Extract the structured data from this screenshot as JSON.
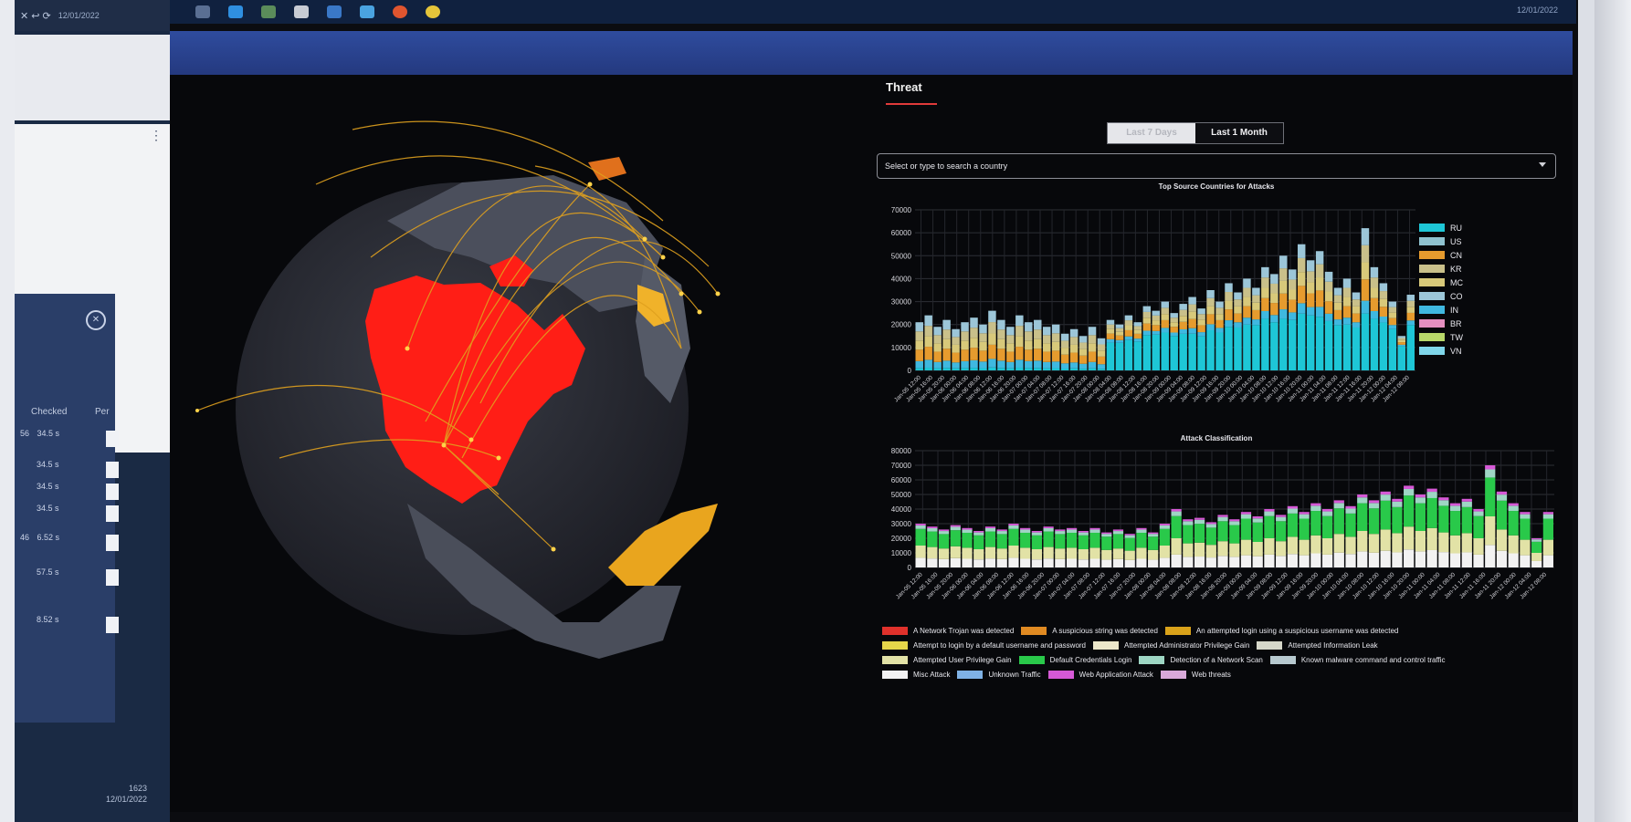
{
  "left_app": {
    "date": "12/01/2022",
    "menu_icon": "kebab-menu-icon",
    "columns": [
      "Checked",
      "Per"
    ],
    "rows": [
      "34.5 s",
      "34.5 s",
      "34.5 s",
      "34.5 s",
      "6.52 s",
      "57.5 s",
      "8.52 s"
    ],
    "row_prefix_first": "56",
    "row_prefix_fifth": "46",
    "clock_time": "1623",
    "clock_date": "12/01/2022"
  },
  "taskbar": {
    "date": "12/01/2022",
    "icons": [
      {
        "name": "file-explorer-icon",
        "color": "#5a6f93"
      },
      {
        "name": "browser-icon",
        "color": "#2f8fe0"
      },
      {
        "name": "folder-icon",
        "color": "#5b8c5a"
      },
      {
        "name": "app-icon",
        "color": "#c8ccd4"
      },
      {
        "name": "store-icon",
        "color": "#3a78c7"
      },
      {
        "name": "mail-icon",
        "color": "#4aa3e0"
      },
      {
        "name": "firefox-icon",
        "color": "#e0552f"
      },
      {
        "name": "chrome-icon",
        "color": "#e5c53a"
      }
    ]
  },
  "dashboard": {
    "tab": "Threat",
    "range_options": [
      "Last 7 Days",
      "Last 1 Month"
    ],
    "search_placeholder": "Select or type to search a country"
  },
  "chart_data": [
    {
      "type": "bar",
      "stacked": true,
      "title": "Top Source Countries for Attacks",
      "ylim": [
        0,
        70000
      ],
      "yticks": [
        0,
        10000,
        20000,
        30000,
        40000,
        50000,
        60000,
        70000
      ],
      "grid": true,
      "legend_position": "right",
      "xtick_labels": [
        "Jan-05 12:00",
        "Jan-05 16:00",
        "Jan-05 20:00",
        "Jan-06 00:00",
        "Jan-06 04:00",
        "Jan-06 08:00",
        "Jan-06 12:00",
        "Jan-06 16:00",
        "Jan-06 20:00",
        "Jan-07 00:00",
        "Jan-07 04:00",
        "Jan-07 08:00",
        "Jan-07 12:00",
        "Jan-07 16:00",
        "Jan-07 20:00",
        "Jan-08 00:00",
        "Jan-08 04:00",
        "Jan-08 08:00",
        "Jan-08 12:00",
        "Jan-08 16:00",
        "Jan-08 20:00",
        "Jan-09 00:00",
        "Jan-09 04:00",
        "Jan-09 08:00",
        "Jan-09 12:00",
        "Jan-09 16:00",
        "Jan-09 20:00",
        "Jan-10 00:00",
        "Jan-10 04:00",
        "Jan-10 08:00",
        "Jan-10 12:00",
        "Jan-10 16:00",
        "Jan-10 20:00",
        "Jan-11 00:00",
        "Jan-11 04:00",
        "Jan-11 08:00",
        "Jan-11 12:00",
        "Jan-11 16:00",
        "Jan-11 20:00",
        "Jan-12 00:00",
        "Jan-12 04:00",
        "Jan-12 08:00"
      ],
      "series": [
        {
          "name": "RU",
          "color": "#1ec6d6"
        },
        {
          "name": "US",
          "color": "#8fc2cf"
        },
        {
          "name": "CN",
          "color": "#e69b2e"
        },
        {
          "name": "KR",
          "color": "#c9c08a"
        },
        {
          "name": "MC",
          "color": "#d8c97a"
        },
        {
          "name": "CO",
          "color": "#9cc6d8"
        },
        {
          "name": "IN",
          "color": "#3fb8e0"
        },
        {
          "name": "BR",
          "color": "#e58fc0"
        },
        {
          "name": "TW",
          "color": "#b9d86a"
        },
        {
          "name": "VN",
          "color": "#7fd6ea"
        }
      ],
      "totals": [
        21000,
        24000,
        19000,
        22000,
        18000,
        21000,
        23000,
        20000,
        26000,
        22000,
        19000,
        24000,
        21000,
        22000,
        19000,
        20000,
        16000,
        18000,
        15000,
        19000,
        14000,
        22000,
        20000,
        24000,
        21000,
        28000,
        26000,
        30000,
        25000,
        29000,
        32000,
        27000,
        35000,
        30000,
        38000,
        34000,
        40000,
        36000,
        45000,
        42000,
        50000,
        44000,
        55000,
        48000,
        52000,
        43000,
        36000,
        40000,
        34000,
        62000,
        45000,
        38000,
        30000,
        15000,
        33000
      ],
      "ru_share": [
        0.05,
        0.05,
        0.05,
        0.05,
        0.05,
        0.05,
        0.05,
        0.05,
        0.05,
        0.05,
        0.05,
        0.05,
        0.05,
        0.05,
        0.05,
        0.05,
        0.05,
        0.05,
        0.05,
        0.05,
        0.05,
        0.55,
        0.6,
        0.55,
        0.6,
        0.55,
        0.6,
        0.55,
        0.6,
        0.55,
        0.5,
        0.55,
        0.5,
        0.55,
        0.5,
        0.55,
        0.5,
        0.55,
        0.5,
        0.5,
        0.45,
        0.5,
        0.45,
        0.5,
        0.45,
        0.5,
        0.55,
        0.5,
        0.55,
        0.4,
        0.5,
        0.55,
        0.6,
        0.7,
        0.6
      ]
    },
    {
      "type": "bar",
      "stacked": true,
      "title": "Attack Classification",
      "ylim": [
        0,
        80000
      ],
      "yticks": [
        0,
        10000,
        20000,
        30000,
        40000,
        50000,
        60000,
        70000,
        80000
      ],
      "grid": true,
      "legend_position": "bottom",
      "xtick_labels": [
        "Jan-05 12:00",
        "Jan-05 16:00",
        "Jan-05 20:00",
        "Jan-06 00:00",
        "Jan-06 04:00",
        "Jan-06 08:00",
        "Jan-06 12:00",
        "Jan-06 16:00",
        "Jan-06 20:00",
        "Jan-07 00:00",
        "Jan-07 04:00",
        "Jan-07 08:00",
        "Jan-07 12:00",
        "Jan-07 16:00",
        "Jan-07 20:00",
        "Jan-08 00:00",
        "Jan-08 04:00",
        "Jan-08 08:00",
        "Jan-08 12:00",
        "Jan-08 16:00",
        "Jan-08 20:00",
        "Jan-09 00:00",
        "Jan-09 04:00",
        "Jan-09 08:00",
        "Jan-09 12:00",
        "Jan-09 16:00",
        "Jan-09 20:00",
        "Jan-10 00:00",
        "Jan-10 04:00",
        "Jan-10 08:00",
        "Jan-10 12:00",
        "Jan-10 16:00",
        "Jan-10 20:00",
        "Jan-11 00:00",
        "Jan-11 04:00",
        "Jan-11 08:00",
        "Jan-11 12:00",
        "Jan-11 16:00",
        "Jan-11 20:00",
        "Jan-12 00:00",
        "Jan-12 04:00",
        "Jan-12 08:00"
      ],
      "series": [
        {
          "name": "A Network Trojan was detected",
          "color": "#e0312b"
        },
        {
          "name": "A suspicious string was detected",
          "color": "#e08a22"
        },
        {
          "name": "An attempted login using a suspicious username was detected",
          "color": "#d9a21a"
        },
        {
          "name": "Attempt to login by a default username and password",
          "color": "#e6d64a"
        },
        {
          "name": "Attempted Administrator Privilege Gain",
          "color": "#ece7c9"
        },
        {
          "name": "Attempted Information Leak",
          "color": "#d5d6c8"
        },
        {
          "name": "Attempted User Privilege Gain",
          "color": "#e2e2a6"
        },
        {
          "name": "Default Credentials Login",
          "color": "#29c94a"
        },
        {
          "name": "Detection of a Network Scan",
          "color": "#9ed6c4"
        },
        {
          "name": "Known malware command and control traffic",
          "color": "#b7c9cf"
        },
        {
          "name": "Misc Attack",
          "color": "#f2f2f2"
        },
        {
          "name": "Unknown Traffic",
          "color": "#7fb2e6"
        },
        {
          "name": "Web Application Attack",
          "color": "#d659d6"
        },
        {
          "name": "Web threats",
          "color": "#d9a9d9"
        }
      ],
      "totals": [
        30000,
        28000,
        26000,
        29000,
        27000,
        25000,
        28000,
        26000,
        30000,
        27000,
        25000,
        28000,
        26000,
        27000,
        25000,
        27000,
        24000,
        26000,
        23000,
        27000,
        24000,
        30000,
        40000,
        33000,
        34000,
        31000,
        36000,
        33000,
        38000,
        35000,
        40000,
        36000,
        42000,
        38000,
        44000,
        40000,
        46000,
        42000,
        50000,
        46000,
        52000,
        47000,
        56000,
        50000,
        54000,
        48000,
        44000,
        47000,
        40000,
        70000,
        52000,
        44000,
        38000,
        20000,
        38000
      ]
    }
  ]
}
